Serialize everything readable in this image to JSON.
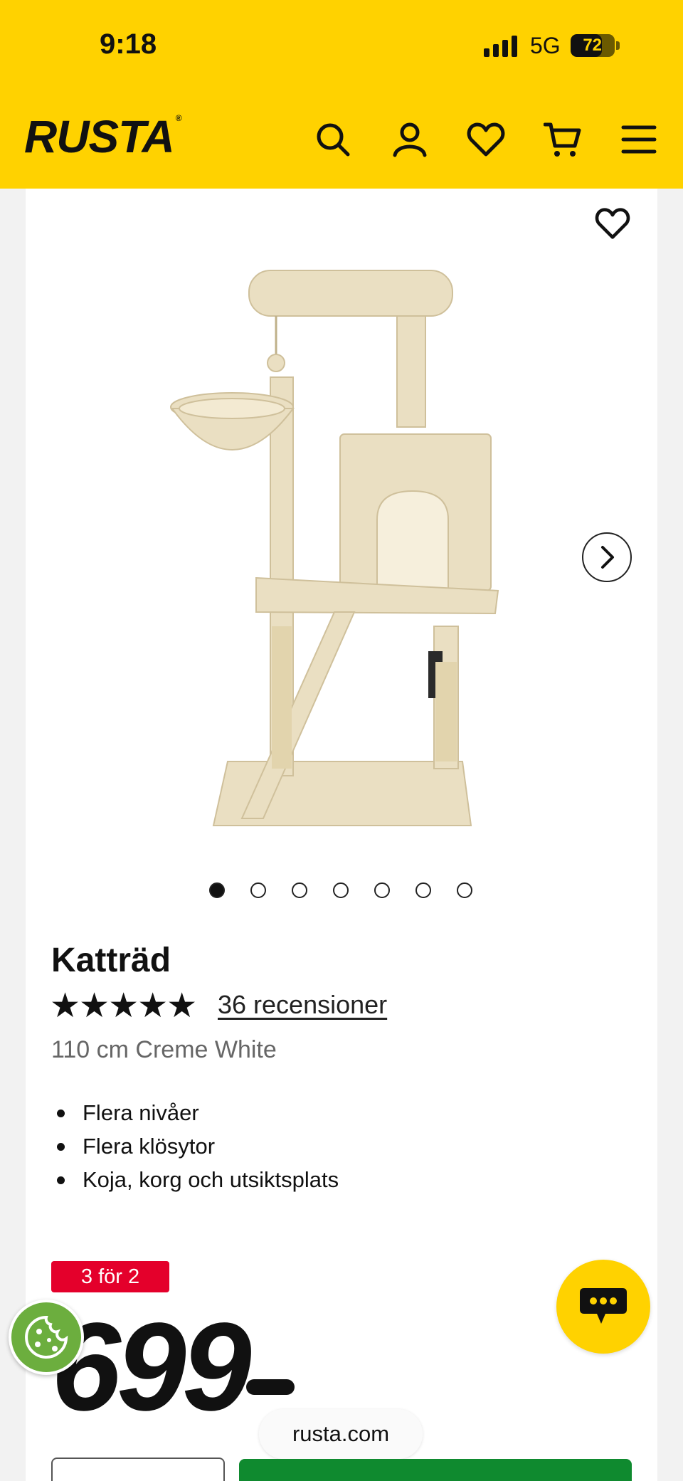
{
  "status_bar": {
    "time": "9:18",
    "network": "5G",
    "battery": "72",
    "battery_level": 0.72
  },
  "header": {
    "logo": "RUSTA",
    "icons": [
      "search-icon",
      "user-icon",
      "heart-icon",
      "cart-icon",
      "menu-icon"
    ]
  },
  "product": {
    "title": "Katträd",
    "rating": 5,
    "stars": "★★★★★",
    "reviews": "36 recensioner",
    "variant": "110 cm Creme White",
    "features": [
      "Flera nivåer",
      "Flera klösytor",
      "Koja, korg och utsiktsplats"
    ],
    "badge": "3 för 2",
    "price": "699",
    "image_count": 7,
    "active_image": 1
  },
  "browser": {
    "url": "rusta.com"
  },
  "colors": {
    "brand_yellow": "#ffd200",
    "badge_red": "#e4002b",
    "buy_green": "#0f8a2f",
    "cookie_green": "#6cae3e"
  }
}
